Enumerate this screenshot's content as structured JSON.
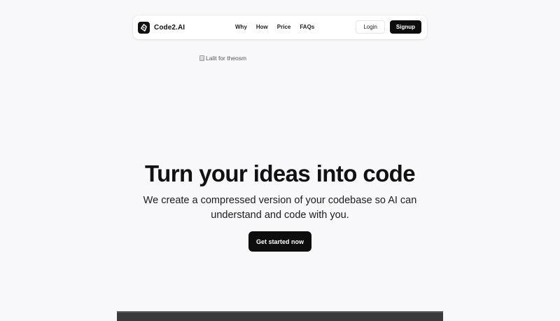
{
  "navbar": {
    "brand": {
      "name": "Code2.AI",
      "logo_icon": "code2-logo-icon"
    },
    "links": [
      {
        "label": "Why"
      },
      {
        "label": "How"
      },
      {
        "label": "Price"
      },
      {
        "label": "FAQs"
      }
    ],
    "login_label": "Login",
    "signup_label": "Signup"
  },
  "hero_image": {
    "alt_text": "Lalit for theosm",
    "state": "broken-image"
  },
  "hero": {
    "title": "Turn your ideas into code",
    "subtitle": "We create a compressed version of your codebase so AI can understand and code with you.",
    "cta_label": "Get started now"
  },
  "colors": {
    "page_background": "#f8f8fa",
    "navbar_background": "#ffffff",
    "primary_button": "#0d0d0d",
    "primary_button_text": "#ffffff",
    "text": "#111111",
    "preview_strip": "#3a3a3c"
  }
}
